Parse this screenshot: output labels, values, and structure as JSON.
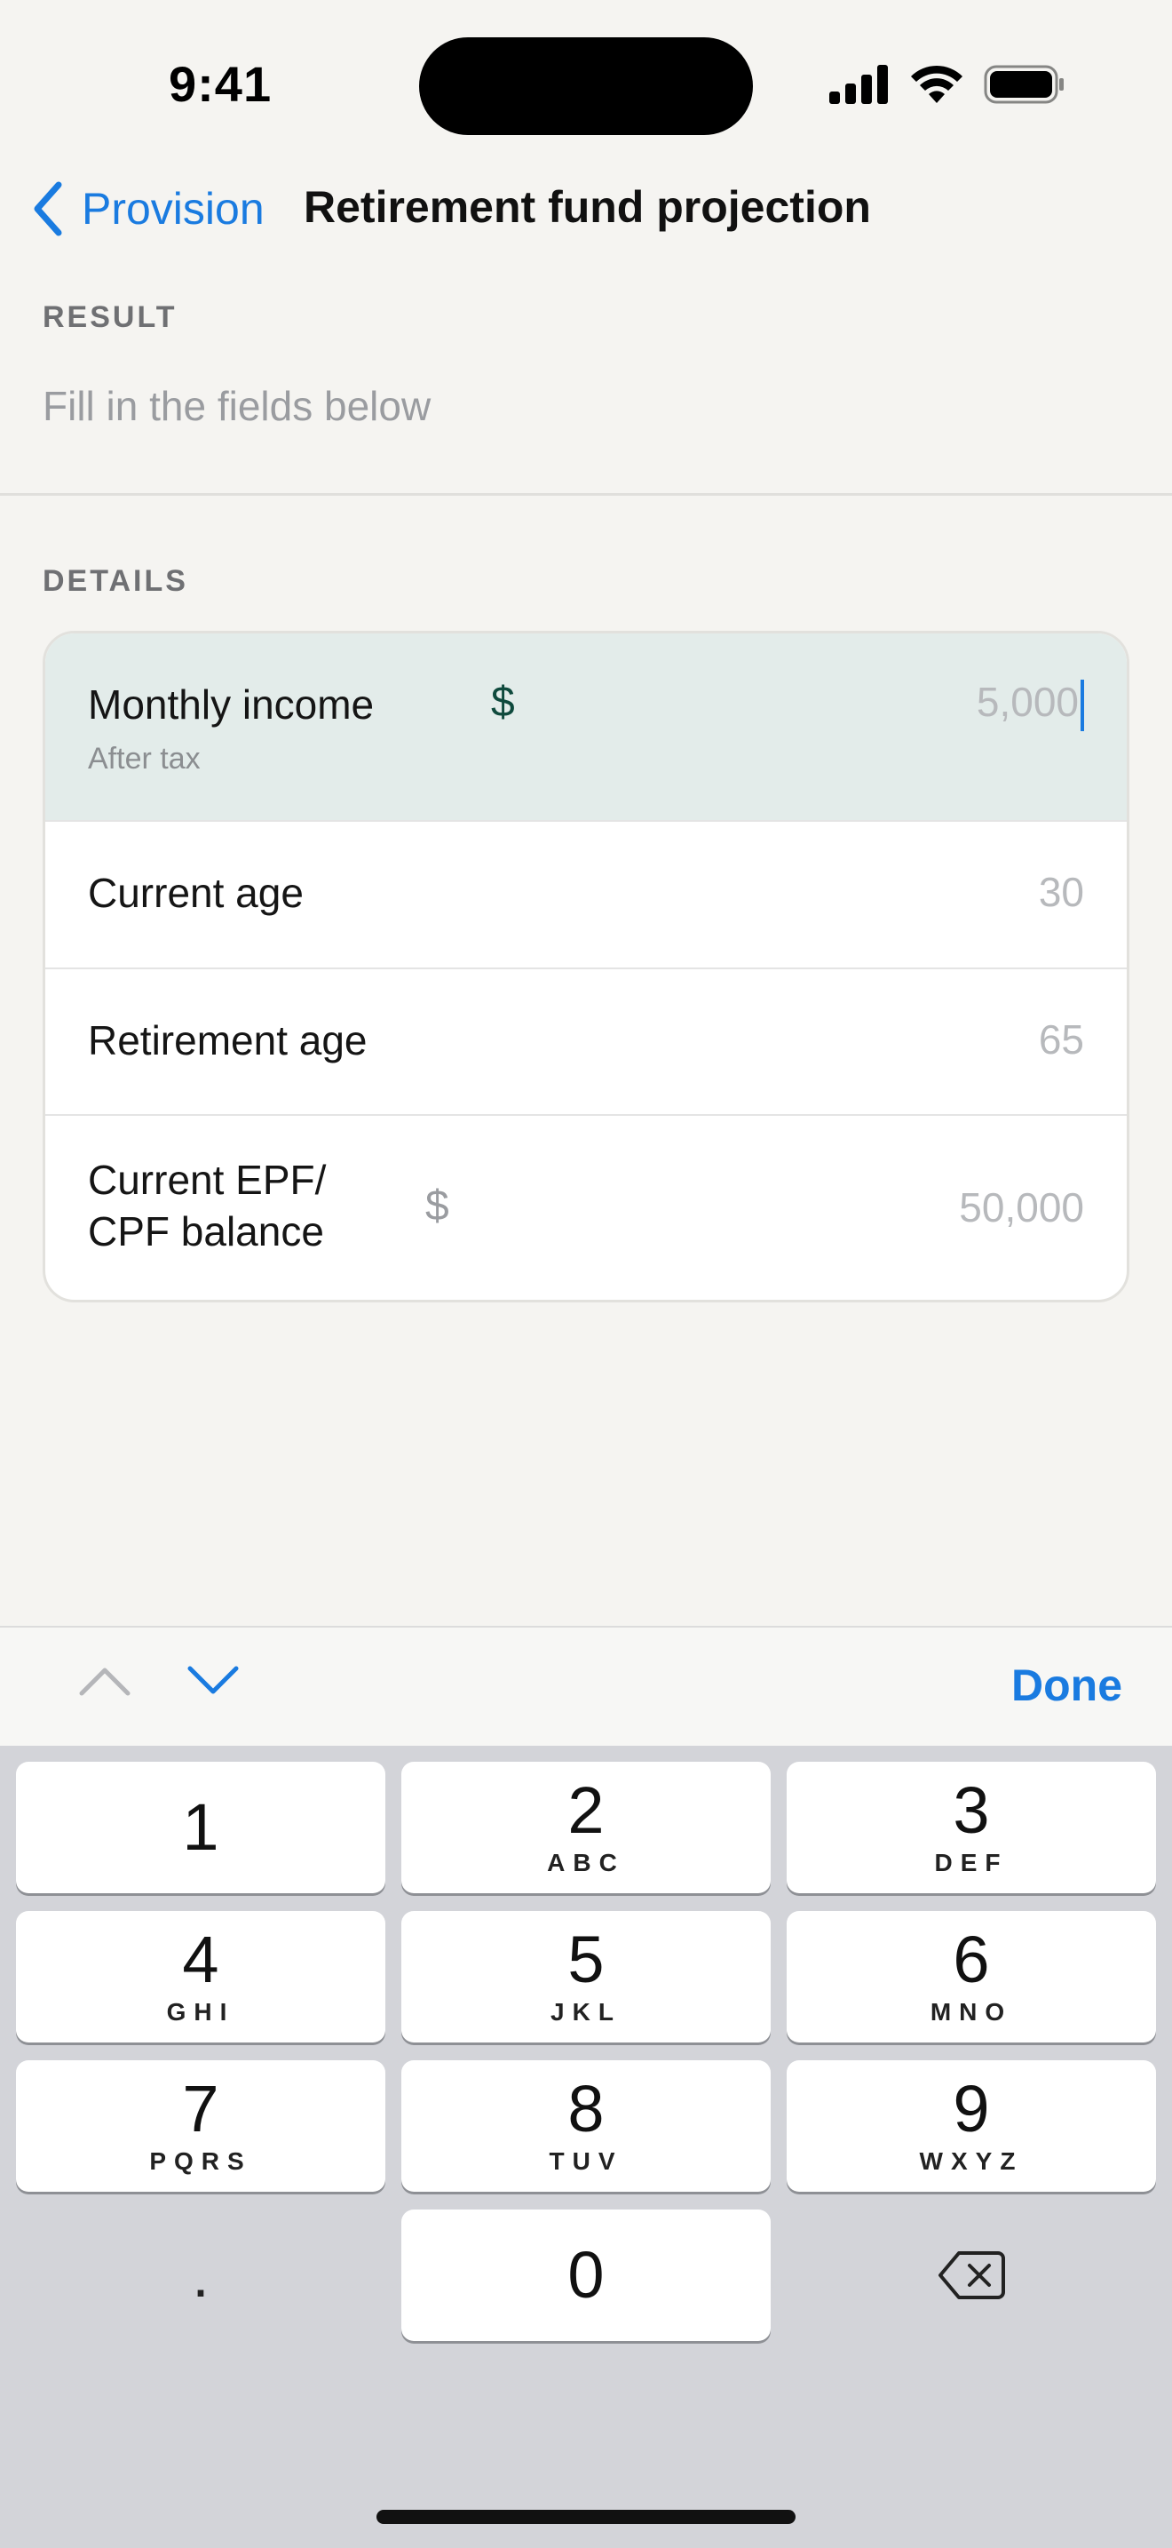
{
  "status_bar": {
    "time": "9:41"
  },
  "nav": {
    "back_label": "Provision",
    "title": "Retirement fund projection"
  },
  "result": {
    "section_label": "RESULT",
    "hint": "Fill in the fields below"
  },
  "details": {
    "section_label": "DETAILS",
    "fields": [
      {
        "label": "Monthly income",
        "sublabel": "After tax",
        "currency": "$",
        "placeholder": "5,000",
        "active": true
      },
      {
        "label": "Current age",
        "placeholder": "30"
      },
      {
        "label": "Retirement age",
        "placeholder": "65"
      },
      {
        "label_line1": "Current EPF/",
        "label_line2": "CPF balance",
        "currency": "$",
        "placeholder": "50,000"
      }
    ]
  },
  "accessory": {
    "done_label": "Done",
    "prev_icon": "chevron-up-icon",
    "next_icon": "chevron-down-icon"
  },
  "keypad": {
    "keys": [
      {
        "digit": "1",
        "letters": ""
      },
      {
        "digit": "2",
        "letters": "ABC"
      },
      {
        "digit": "3",
        "letters": "DEF"
      },
      {
        "digit": "4",
        "letters": "GHI"
      },
      {
        "digit": "5",
        "letters": "JKL"
      },
      {
        "digit": "6",
        "letters": "MNO"
      },
      {
        "digit": "7",
        "letters": "PQRS"
      },
      {
        "digit": "8",
        "letters": "TUV"
      },
      {
        "digit": "9",
        "letters": "WXYZ"
      },
      {
        "digit": "0",
        "letters": ""
      }
    ],
    "decimal": ".",
    "delete_icon": "backspace-icon"
  },
  "colors": {
    "accent": "#1a7be0",
    "active_row": "#e3ecea",
    "currency_active": "#0f4a3d",
    "keyboard_bg": "#d3d4d9"
  }
}
